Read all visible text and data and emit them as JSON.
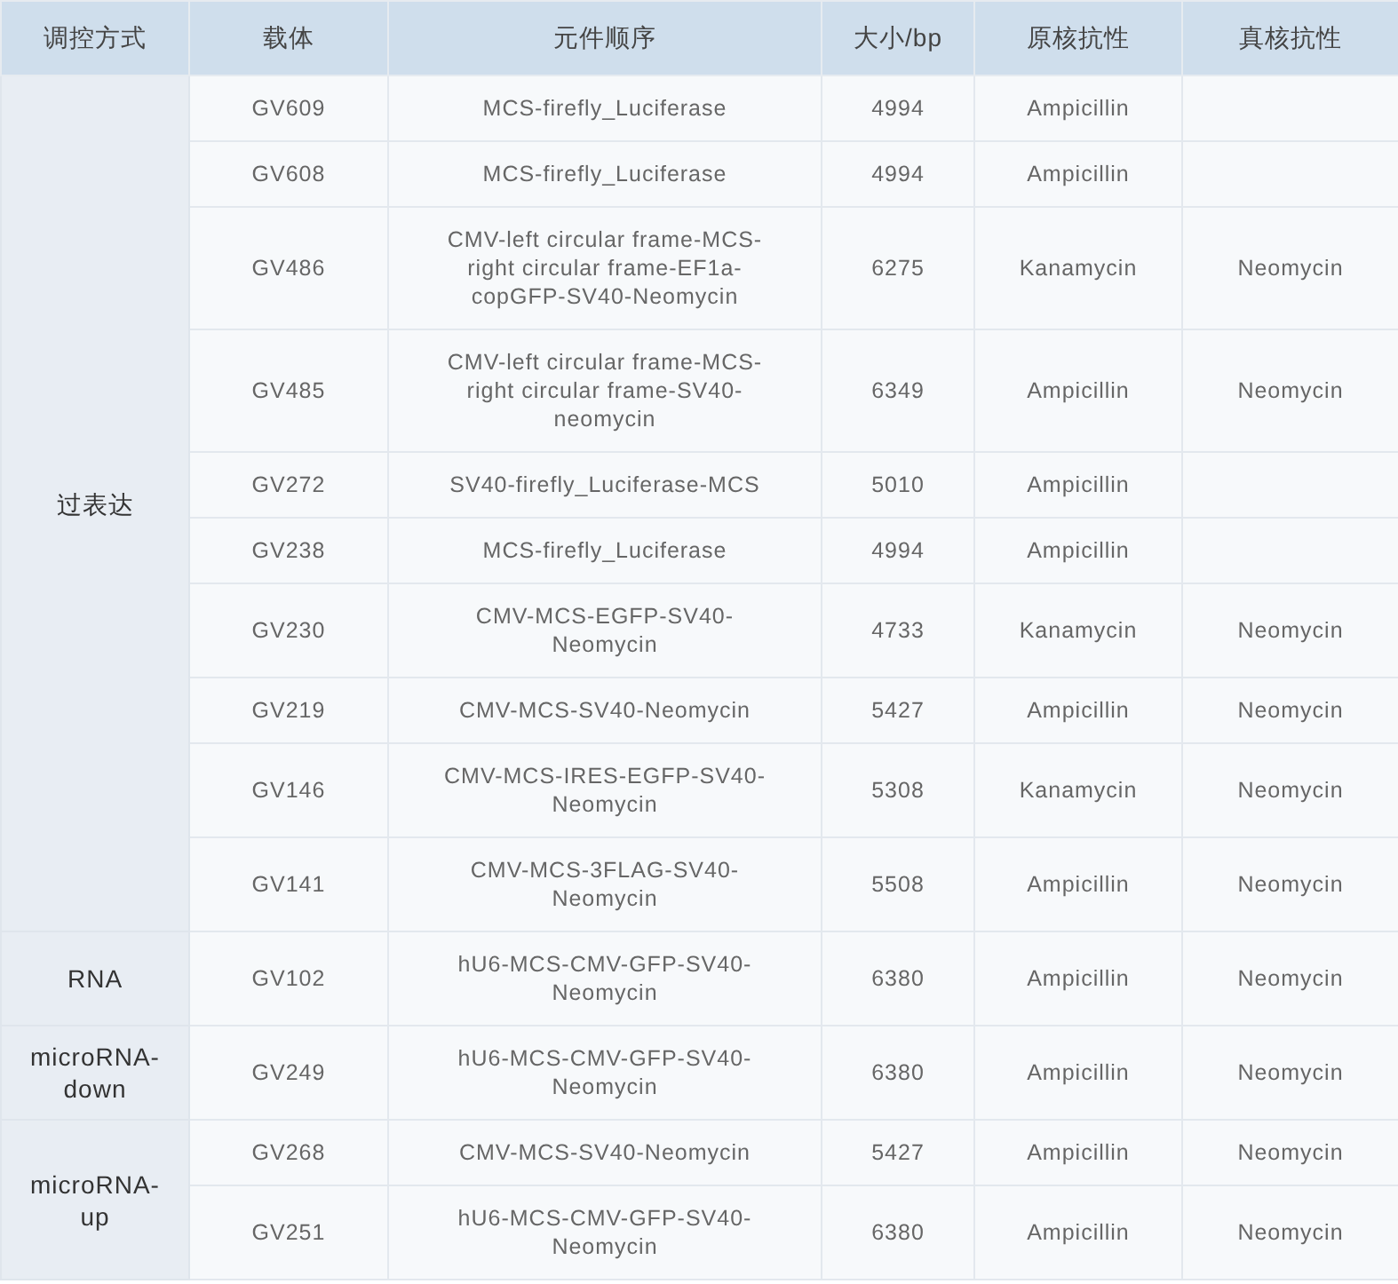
{
  "table": {
    "columns": [
      "调控方式",
      "载体",
      "元件顺序",
      "大小/bp",
      "原核抗性",
      "真核抗性"
    ],
    "groups": [
      {
        "label": "过表达",
        "rows": [
          {
            "vector": "GV609",
            "elements": "MCS-firefly_Luciferase",
            "size": "4994",
            "prokaryotic": "Ampicillin"
          },
          {
            "vector": "GV608",
            "elements": "MCS-firefly_Luciferase",
            "size": "4994",
            "prokaryotic": "Ampicillin"
          },
          {
            "vector": "GV486",
            "elements": "CMV-left circular frame-MCS-right circular frame-EF1a-copGFP-SV40-Neomycin",
            "size": "6275",
            "prokaryotic": "Kanamycin",
            "eukaryotic": "Neomycin"
          },
          {
            "vector": "GV485",
            "elements": "CMV-left circular frame-MCS-right circular frame-SV40-neomycin",
            "size": "6349",
            "prokaryotic": "Ampicillin",
            "eukaryotic": "Neomycin"
          },
          {
            "vector": "GV272",
            "elements": "SV40-firefly_Luciferase-MCS",
            "size": "5010",
            "prokaryotic": "Ampicillin"
          },
          {
            "vector": "GV238",
            "elements": "MCS-firefly_Luciferase",
            "size": "4994",
            "prokaryotic": "Ampicillin"
          },
          {
            "vector": "GV230",
            "elements": "CMV-MCS-EGFP-SV40-Neomycin",
            "size": "4733",
            "prokaryotic": "Kanamycin",
            "eukaryotic": "Neomycin"
          },
          {
            "vector": "GV219",
            "elements": "CMV-MCS-SV40-Neomycin",
            "size": "5427",
            "prokaryotic": "Ampicillin",
            "eukaryotic": "Neomycin"
          },
          {
            "vector": "GV146",
            "elements": "CMV-MCS-IRES-EGFP-SV40-Neomycin",
            "size": "5308",
            "prokaryotic": "Kanamycin",
            "eukaryotic": "Neomycin"
          },
          {
            "vector": "GV141",
            "elements": "CMV-MCS-3FLAG-SV40-Neomycin",
            "size": "5508",
            "prokaryotic": "Ampicillin",
            "eukaryotic": "Neomycin"
          }
        ]
      },
      {
        "label": "RNA",
        "rows": [
          {
            "vector": "GV102",
            "elements": "hU6-MCS-CMV-GFP-SV40-Neomycin",
            "size": "6380",
            "prokaryotic": "Ampicillin",
            "eukaryotic": "Neomycin"
          }
        ]
      },
      {
        "label": "microRNA-down",
        "rows": [
          {
            "vector": "GV249",
            "elements": "hU6-MCS-CMV-GFP-SV40-Neomycin",
            "size": "6380",
            "prokaryotic": "Ampicillin",
            "eukaryotic": "Neomycin"
          }
        ]
      },
      {
        "label": "microRNA-up",
        "rows": [
          {
            "vector": "GV268",
            "elements": "CMV-MCS-SV40-Neomycin",
            "size": "5427",
            "prokaryotic": "Ampicillin",
            "eukaryotic": "Neomycin"
          },
          {
            "vector": "GV251",
            "elements": "hU6-MCS-CMV-GFP-SV40-Neomycin",
            "size": "6380",
            "prokaryotic": "Ampicillin",
            "eukaryotic": "Neomycin"
          }
        ]
      }
    ]
  }
}
